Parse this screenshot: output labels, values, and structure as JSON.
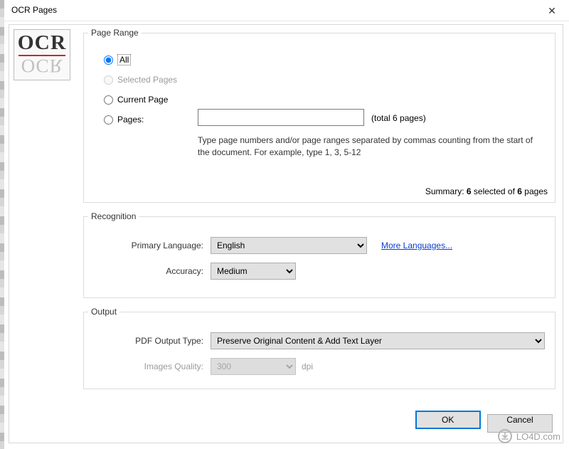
{
  "window": {
    "title": "OCR Pages"
  },
  "icon": {
    "line1": "OCR",
    "line2": "OCR"
  },
  "pageRange": {
    "legend": "Page Range",
    "options": {
      "all": "All",
      "selected": "Selected Pages",
      "current": "Current Page",
      "pages": "Pages:"
    },
    "pagesValue": "",
    "totalText": "(total 6 pages)",
    "hint": "Type page numbers and/or page ranges separated by commas counting from the start of the document. For example, type 1, 3, 5-12",
    "summary_prefix": "Summary: ",
    "summary_selected": "6",
    "summary_mid": " selected of ",
    "summary_total": "6",
    "summary_suffix": " pages"
  },
  "recognition": {
    "legend": "Recognition",
    "primaryLabel": "Primary Language:",
    "primaryValue": "English",
    "moreLink": "More Languages...",
    "accuracyLabel": "Accuracy:",
    "accuracyValue": "Medium"
  },
  "output": {
    "legend": "Output",
    "typeLabel": "PDF Output Type:",
    "typeValue": "Preserve Original Content & Add Text Layer",
    "qualityLabel": "Images Quality:",
    "qualityValue": "300",
    "dpi": "dpi"
  },
  "buttons": {
    "ok": "OK",
    "cancel": "Cancel"
  },
  "watermark": "LO4D.com"
}
